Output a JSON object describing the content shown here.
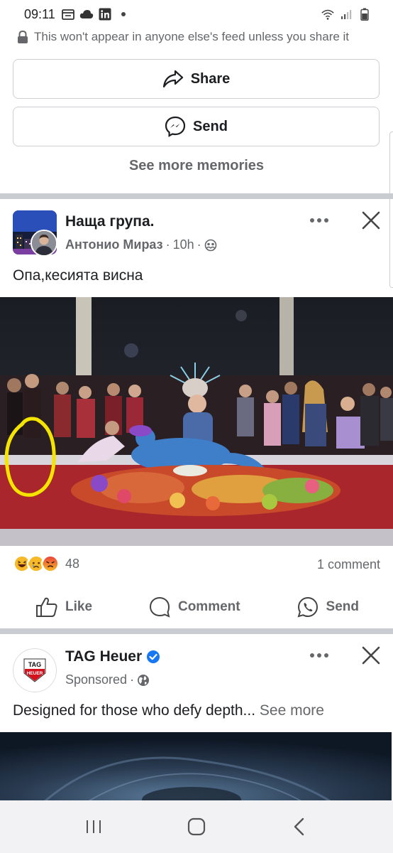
{
  "status_bar": {
    "time": "09:11"
  },
  "memory_card": {
    "privacy_note": "This won't appear in anyone else's feed unless you share it",
    "share_label": "Share",
    "send_label": "Send",
    "see_more_memories": "See more memories"
  },
  "post": {
    "group_name": "Наща група.",
    "author": "Антонио Мираз",
    "time": "10h",
    "separator": "·",
    "text": "Опа,кесията висна",
    "reaction_count": "48",
    "comment_count": "1 comment",
    "actions": {
      "like": "Like",
      "comment": "Comment",
      "send": "Send"
    }
  },
  "ad": {
    "brand": "TAG Heuer",
    "logo_line1": "TAG",
    "logo_line2": "HEUER",
    "sponsored": "Sponsored",
    "separator": "·",
    "text": "Designed for those who defy depth...",
    "see_more": "See more"
  },
  "colors": {
    "text_primary": "#1c1e21",
    "text_secondary": "#65676b",
    "divider": "#c9ccd1",
    "verified_blue": "#1877f2",
    "annotation_yellow": "#f5e400",
    "tag_red": "#d4121e"
  }
}
